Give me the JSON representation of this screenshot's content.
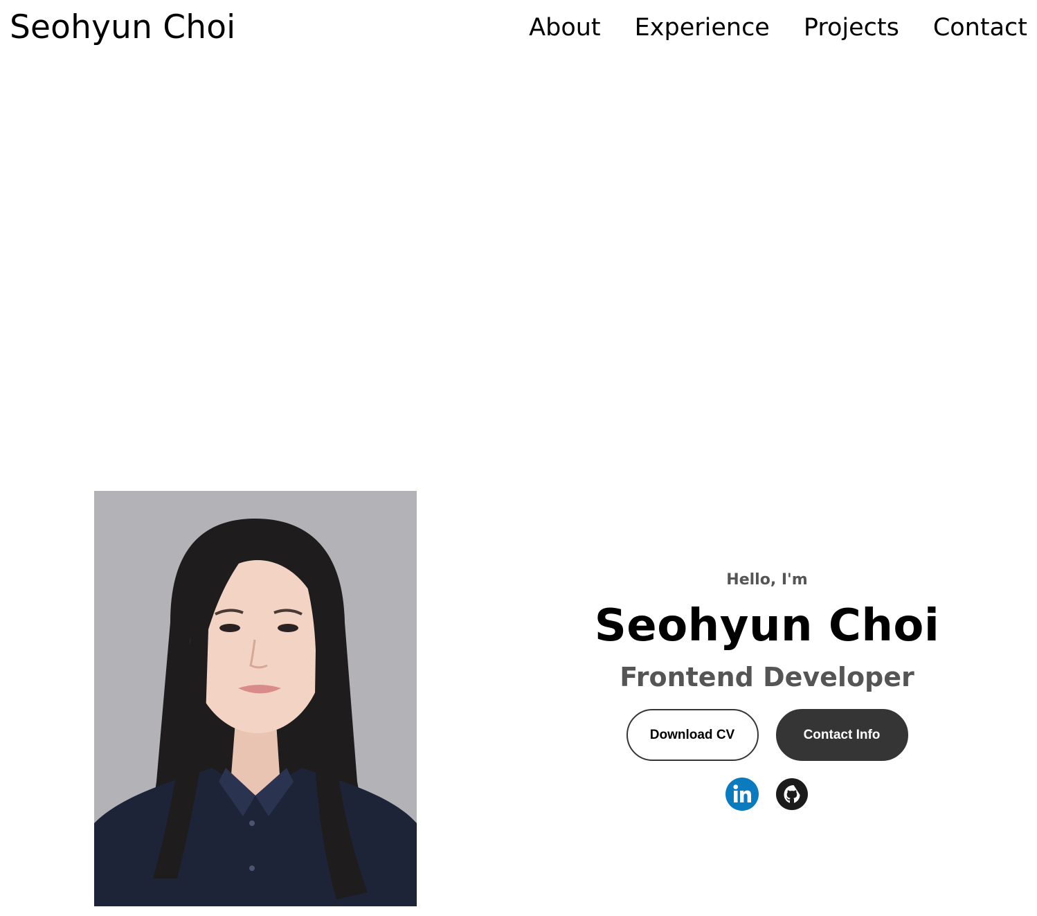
{
  "header": {
    "logo": "Seohyun Choi",
    "nav": [
      "About",
      "Experience",
      "Projects",
      "Contact"
    ]
  },
  "hero": {
    "greeting": "Hello, I'm",
    "name": "Seohyun Choi",
    "title": "Frontend Developer",
    "buttons": {
      "download_cv": "Download CV",
      "contact_info": "Contact Info"
    },
    "socials": [
      {
        "icon": "linkedin-icon",
        "color": "#0a7bbf"
      },
      {
        "icon": "github-icon",
        "color": "#1b1b1b"
      }
    ]
  },
  "colors": {
    "accent_dark": "#353535",
    "muted_text": "#555555",
    "linkedin": "#0a7bbf"
  }
}
